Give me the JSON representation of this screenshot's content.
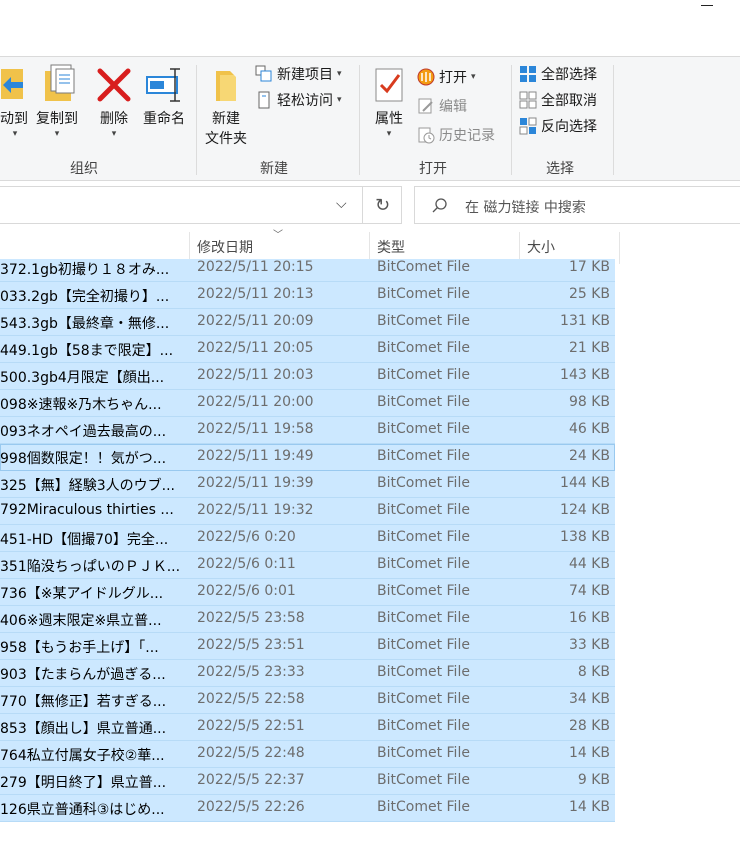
{
  "window": {
    "minimize_label": ""
  },
  "ribbon": {
    "organize": {
      "move_to": "动到",
      "copy_to": "复制到",
      "delete": "删除",
      "rename": "重命名",
      "group": "组织"
    },
    "new": {
      "new_folder_line1": "新建",
      "new_folder_line2": "文件夹",
      "new_item": "新建项目",
      "easy_access": "轻松访问",
      "group": "新建"
    },
    "open": {
      "properties": "属性",
      "open": "打开",
      "edit": "编辑",
      "history": "历史记录",
      "group": "打开"
    },
    "select": {
      "select_all": "全部选择",
      "select_none": "全部取消",
      "invert": "反向选择",
      "group": "选择"
    }
  },
  "search": {
    "placeholder": "在 磁力链接 中搜索"
  },
  "columns": {
    "date": "修改日期",
    "type": "类型",
    "size": "大小"
  },
  "files": [
    {
      "name": "372.1gb初撮り１８オみ...",
      "date": "2022/5/11 20:15",
      "type": "BitComet File",
      "size": "17 KB"
    },
    {
      "name": "033.2gb【完全初撮り】...",
      "date": "2022/5/11 20:13",
      "type": "BitComet File",
      "size": "25 KB"
    },
    {
      "name": "543.3gb【最終章・無修...",
      "date": "2022/5/11 20:09",
      "type": "BitComet File",
      "size": "131 KB"
    },
    {
      "name": "449.1gb【58まで限定】...",
      "date": "2022/5/11 20:05",
      "type": "BitComet File",
      "size": "21 KB"
    },
    {
      "name": "500.3gb4月限定【顔出...",
      "date": "2022/5/11 20:03",
      "type": "BitComet File",
      "size": "143 KB"
    },
    {
      "name": "098※速報※乃木ちゃん...",
      "date": "2022/5/11 20:00",
      "type": "BitComet File",
      "size": "98 KB"
    },
    {
      "name": "093ネオペイ過去最高の...",
      "date": "2022/5/11 19:58",
      "type": "BitComet File",
      "size": "46 KB"
    },
    {
      "name": "998個数限定！！気がつ...",
      "date": "2022/5/11 19:49",
      "type": "BitComet File",
      "size": "24 KB"
    },
    {
      "name": "325【無】経験3人のウブ...",
      "date": "2022/5/11 19:39",
      "type": "BitComet File",
      "size": "144 KB"
    },
    {
      "name": "792Miraculous thirties ...",
      "date": "2022/5/11 19:32",
      "type": "BitComet File",
      "size": "124 KB"
    },
    {
      "name": "451-HD【個撮70】完全...",
      "date": "2022/5/6 0:20",
      "type": "BitComet File",
      "size": "138 KB"
    },
    {
      "name": "351陥没ちっぱいのＰＪＫ...",
      "date": "2022/5/6 0:11",
      "type": "BitComet File",
      "size": "44 KB"
    },
    {
      "name": "736【※某アイドルグル...",
      "date": "2022/5/6 0:01",
      "type": "BitComet File",
      "size": "74 KB"
    },
    {
      "name": "406※週末限定※県立普...",
      "date": "2022/5/5 23:58",
      "type": "BitComet File",
      "size": "16 KB"
    },
    {
      "name": "958【もうお手上げ】「...",
      "date": "2022/5/5 23:51",
      "type": "BitComet File",
      "size": "33 KB"
    },
    {
      "name": "903【たまらんが過ぎる...",
      "date": "2022/5/5 23:33",
      "type": "BitComet File",
      "size": "8 KB"
    },
    {
      "name": "770【無修正】若すぎる...",
      "date": "2022/5/5 22:58",
      "type": "BitComet File",
      "size": "34 KB"
    },
    {
      "name": "853【顔出し】県立普通...",
      "date": "2022/5/5 22:51",
      "type": "BitComet File",
      "size": "28 KB"
    },
    {
      "name": "764私立付属女子校②華...",
      "date": "2022/5/5 22:48",
      "type": "BitComet File",
      "size": "14 KB"
    },
    {
      "name": "279【明日終了】県立普...",
      "date": "2022/5/5 22:37",
      "type": "BitComet File",
      "size": "9 KB"
    },
    {
      "name": "126県立普通科③はじめ...",
      "date": "2022/5/5 22:26",
      "type": "BitComet File",
      "size": "14 KB"
    }
  ]
}
